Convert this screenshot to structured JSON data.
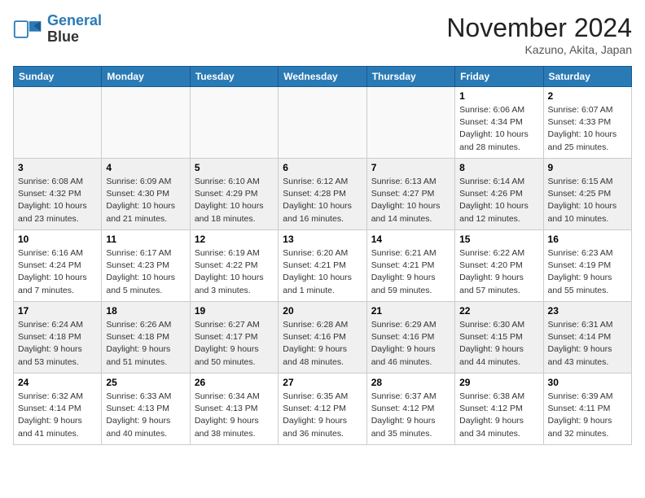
{
  "logo": {
    "line1": "General",
    "line2": "Blue"
  },
  "title": "November 2024",
  "location": "Kazuno, Akita, Japan",
  "days_of_week": [
    "Sunday",
    "Monday",
    "Tuesday",
    "Wednesday",
    "Thursday",
    "Friday",
    "Saturday"
  ],
  "weeks": [
    [
      {
        "day": "",
        "info": ""
      },
      {
        "day": "",
        "info": ""
      },
      {
        "day": "",
        "info": ""
      },
      {
        "day": "",
        "info": ""
      },
      {
        "day": "",
        "info": ""
      },
      {
        "day": "1",
        "info": "Sunrise: 6:06 AM\nSunset: 4:34 PM\nDaylight: 10 hours and 28 minutes."
      },
      {
        "day": "2",
        "info": "Sunrise: 6:07 AM\nSunset: 4:33 PM\nDaylight: 10 hours and 25 minutes."
      }
    ],
    [
      {
        "day": "3",
        "info": "Sunrise: 6:08 AM\nSunset: 4:32 PM\nDaylight: 10 hours and 23 minutes."
      },
      {
        "day": "4",
        "info": "Sunrise: 6:09 AM\nSunset: 4:30 PM\nDaylight: 10 hours and 21 minutes."
      },
      {
        "day": "5",
        "info": "Sunrise: 6:10 AM\nSunset: 4:29 PM\nDaylight: 10 hours and 18 minutes."
      },
      {
        "day": "6",
        "info": "Sunrise: 6:12 AM\nSunset: 4:28 PM\nDaylight: 10 hours and 16 minutes."
      },
      {
        "day": "7",
        "info": "Sunrise: 6:13 AM\nSunset: 4:27 PM\nDaylight: 10 hours and 14 minutes."
      },
      {
        "day": "8",
        "info": "Sunrise: 6:14 AM\nSunset: 4:26 PM\nDaylight: 10 hours and 12 minutes."
      },
      {
        "day": "9",
        "info": "Sunrise: 6:15 AM\nSunset: 4:25 PM\nDaylight: 10 hours and 10 minutes."
      }
    ],
    [
      {
        "day": "10",
        "info": "Sunrise: 6:16 AM\nSunset: 4:24 PM\nDaylight: 10 hours and 7 minutes."
      },
      {
        "day": "11",
        "info": "Sunrise: 6:17 AM\nSunset: 4:23 PM\nDaylight: 10 hours and 5 minutes."
      },
      {
        "day": "12",
        "info": "Sunrise: 6:19 AM\nSunset: 4:22 PM\nDaylight: 10 hours and 3 minutes."
      },
      {
        "day": "13",
        "info": "Sunrise: 6:20 AM\nSunset: 4:21 PM\nDaylight: 10 hours and 1 minute."
      },
      {
        "day": "14",
        "info": "Sunrise: 6:21 AM\nSunset: 4:21 PM\nDaylight: 9 hours and 59 minutes."
      },
      {
        "day": "15",
        "info": "Sunrise: 6:22 AM\nSunset: 4:20 PM\nDaylight: 9 hours and 57 minutes."
      },
      {
        "day": "16",
        "info": "Sunrise: 6:23 AM\nSunset: 4:19 PM\nDaylight: 9 hours and 55 minutes."
      }
    ],
    [
      {
        "day": "17",
        "info": "Sunrise: 6:24 AM\nSunset: 4:18 PM\nDaylight: 9 hours and 53 minutes."
      },
      {
        "day": "18",
        "info": "Sunrise: 6:26 AM\nSunset: 4:18 PM\nDaylight: 9 hours and 51 minutes."
      },
      {
        "day": "19",
        "info": "Sunrise: 6:27 AM\nSunset: 4:17 PM\nDaylight: 9 hours and 50 minutes."
      },
      {
        "day": "20",
        "info": "Sunrise: 6:28 AM\nSunset: 4:16 PM\nDaylight: 9 hours and 48 minutes."
      },
      {
        "day": "21",
        "info": "Sunrise: 6:29 AM\nSunset: 4:16 PM\nDaylight: 9 hours and 46 minutes."
      },
      {
        "day": "22",
        "info": "Sunrise: 6:30 AM\nSunset: 4:15 PM\nDaylight: 9 hours and 44 minutes."
      },
      {
        "day": "23",
        "info": "Sunrise: 6:31 AM\nSunset: 4:14 PM\nDaylight: 9 hours and 43 minutes."
      }
    ],
    [
      {
        "day": "24",
        "info": "Sunrise: 6:32 AM\nSunset: 4:14 PM\nDaylight: 9 hours and 41 minutes."
      },
      {
        "day": "25",
        "info": "Sunrise: 6:33 AM\nSunset: 4:13 PM\nDaylight: 9 hours and 40 minutes."
      },
      {
        "day": "26",
        "info": "Sunrise: 6:34 AM\nSunset: 4:13 PM\nDaylight: 9 hours and 38 minutes."
      },
      {
        "day": "27",
        "info": "Sunrise: 6:35 AM\nSunset: 4:12 PM\nDaylight: 9 hours and 36 minutes."
      },
      {
        "day": "28",
        "info": "Sunrise: 6:37 AM\nSunset: 4:12 PM\nDaylight: 9 hours and 35 minutes."
      },
      {
        "day": "29",
        "info": "Sunrise: 6:38 AM\nSunset: 4:12 PM\nDaylight: 9 hours and 34 minutes."
      },
      {
        "day": "30",
        "info": "Sunrise: 6:39 AM\nSunset: 4:11 PM\nDaylight: 9 hours and 32 minutes."
      }
    ]
  ]
}
